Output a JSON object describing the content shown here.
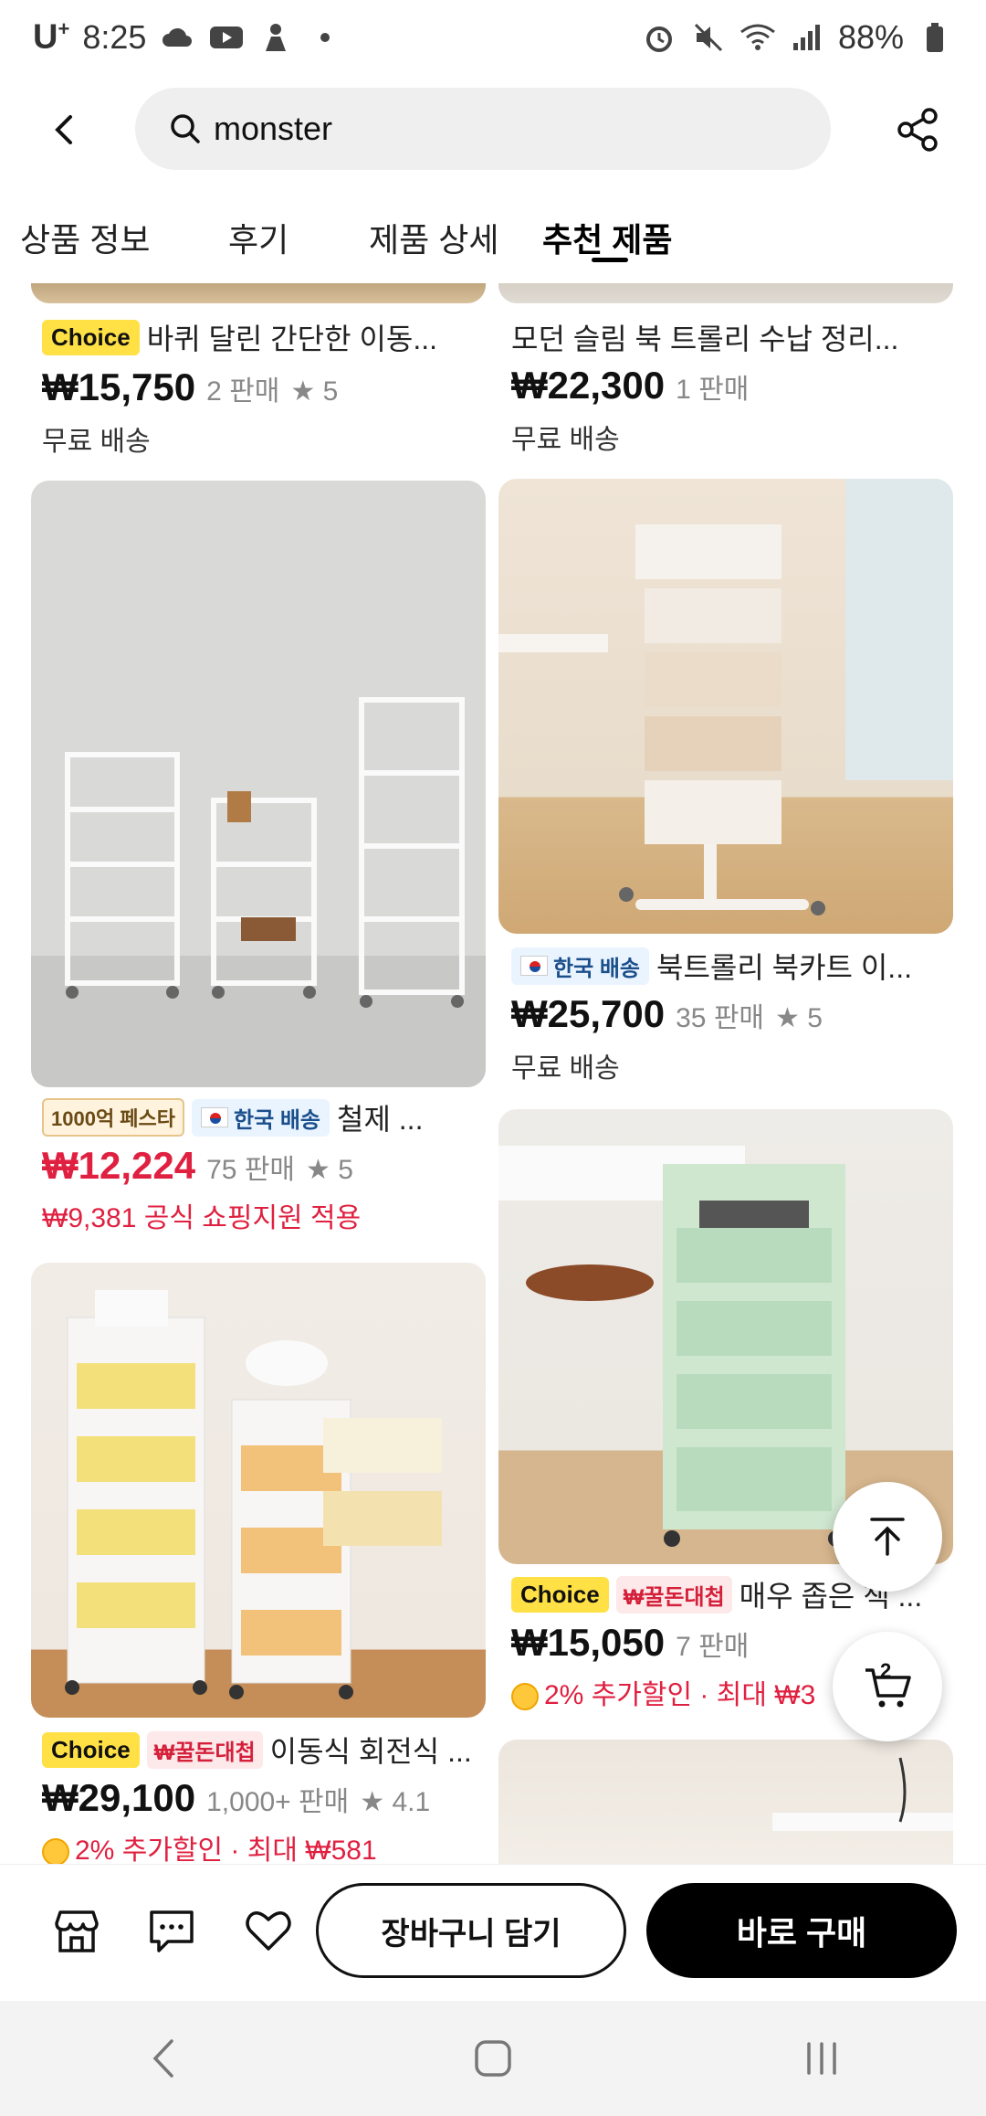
{
  "status_bar": {
    "carrier": "U",
    "carrier_sup": "+",
    "time": "8:25",
    "battery": "88%"
  },
  "header": {
    "search_text": "monster"
  },
  "tabs": [
    {
      "label": "상품 정보"
    },
    {
      "label": "후기"
    },
    {
      "label": "제품 상세"
    },
    {
      "label": "추천 제품"
    }
  ],
  "products": [
    {
      "title": "바퀴 달린 간단한 이동...",
      "badge_choice": "Choice",
      "price": "₩15,750",
      "sold": "2 판매",
      "rating": "5",
      "shipping": "무료 배송"
    },
    {
      "title": "모던 슬림 북 트롤리 수납 정리...",
      "price": "₩22,300",
      "sold": "1 판매",
      "shipping": "무료 배송"
    },
    {
      "title": "철제 ...",
      "badge_fest": "1000억 페스타",
      "badge_korea": "한국 배송",
      "price": "₩12,224",
      "sold": "75 판매",
      "rating": "5",
      "promo": "₩9,381 공식 쇼핑지원 적용"
    },
    {
      "title": "북트롤리 북카트 이...",
      "badge_korea": "한국 배송",
      "price": "₩25,700",
      "sold": "35 판매",
      "rating": "5",
      "shipping": "무료 배송"
    },
    {
      "title": "이동식 회전식 ...",
      "badge_choice": "Choice",
      "badge_deal": "₩꿀돈대첩",
      "price": "₩29,100",
      "sold": "1,000+ 판매",
      "rating": "4.1",
      "promo": "2% 추가할인 · 최대 ₩581"
    },
    {
      "title": "매우 좁은 책 ...",
      "badge_choice": "Choice",
      "badge_deal": "₩꿀돈대첩",
      "price": "₩15,050",
      "sold": "7 판매",
      "promo": "2% 추가할인 · 최대 ₩3"
    }
  ],
  "fab": {
    "cart_count": "2"
  },
  "action_bar": {
    "cart_label": "장바구니 담기",
    "buy_label": "바로 구매"
  }
}
